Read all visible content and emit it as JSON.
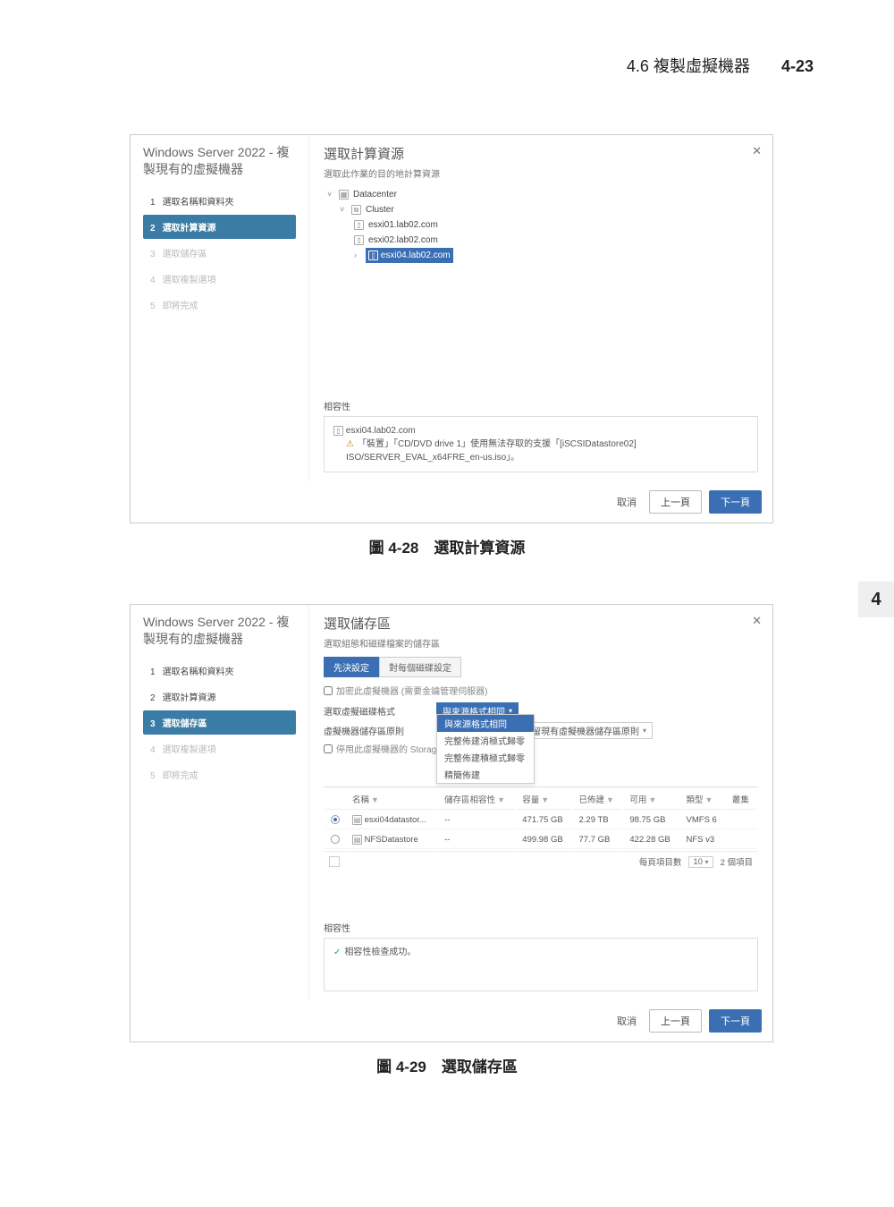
{
  "page": {
    "header_title": "4.6 複製虛擬機器",
    "page_number": "4-23",
    "chapter_tab": "4"
  },
  "wizard_title_1": "Windows Server 2022 - 複",
  "wizard_title_2": "製現有的虛擬機器",
  "steps": [
    {
      "num": "1",
      "label": "選取名稱和資料夾"
    },
    {
      "num": "2",
      "label": "選取計算資源"
    },
    {
      "num": "3",
      "label": "選取儲存區"
    },
    {
      "num": "4",
      "label": "選取複製選項"
    },
    {
      "num": "5",
      "label": "即將完成"
    }
  ],
  "footer": {
    "cancel": "取消",
    "back": "上一頁",
    "next": "下一頁"
  },
  "compat_label": "相容性",
  "screenshot1": {
    "heading": "選取計算資源",
    "sub": "選取此作業的目的地計算資源",
    "tree": {
      "dc": "Datacenter",
      "cluster": "Cluster",
      "hosts": [
        "esxi01.lab02.com",
        "esxi02.lab02.com",
        "esxi04.lab02.com"
      ]
    },
    "compat_host": "esxi04.lab02.com",
    "compat_warn": "「裝置」「CD/DVD drive 1」使用無法存取的支援「[iSCSIDatastore02] ISO/SERVER_EVAL_x64FRE_en-us.iso」。"
  },
  "caption1": "圖 4-28　選取計算資源",
  "screenshot2": {
    "heading": "選取儲存區",
    "sub": "選取組態和磁碟檔案的儲存區",
    "tabs": [
      "先決設定",
      "對每個磁碟設定"
    ],
    "encrypt_label": "加密此虛擬機器 (需要金鑰管理伺服器)",
    "disk_format_label": "選取虛擬磁碟格式",
    "disk_format_value": "與來源格式相同",
    "disk_format_options": [
      "與來源格式相同",
      "完整佈建消極式歸零",
      "完整佈建積極式歸零",
      "精簡佈建"
    ],
    "policy_label": "虛擬機器儲存區原則",
    "policy_value": "保留現有虛擬機器儲存區原則",
    "drs_label": "停用此虛擬機器的 Storage DRS",
    "table": {
      "headers": [
        "",
        "名稱",
        "儲存區相容性",
        "容量",
        "已佈建",
        "可用",
        "類型",
        "叢集"
      ],
      "rows": [
        {
          "selected": true,
          "name": "esxi04datastor...",
          "compat": "--",
          "capacity": "471.75 GB",
          "prov": "2.29 TB",
          "free": "98.75 GB",
          "type": "VMFS 6",
          "cluster": ""
        },
        {
          "selected": false,
          "name": "NFSDatastore",
          "compat": "--",
          "capacity": "499.98 GB",
          "prov": "77.7 GB",
          "free": "422.28 GB",
          "type": "NFS v3",
          "cluster": ""
        }
      ]
    },
    "pager": {
      "label": "每頁項目數",
      "size": "10",
      "total": "2 個項目"
    },
    "compat_ok": "相容性檢查成功。"
  },
  "caption2": "圖 4-29　選取儲存區"
}
